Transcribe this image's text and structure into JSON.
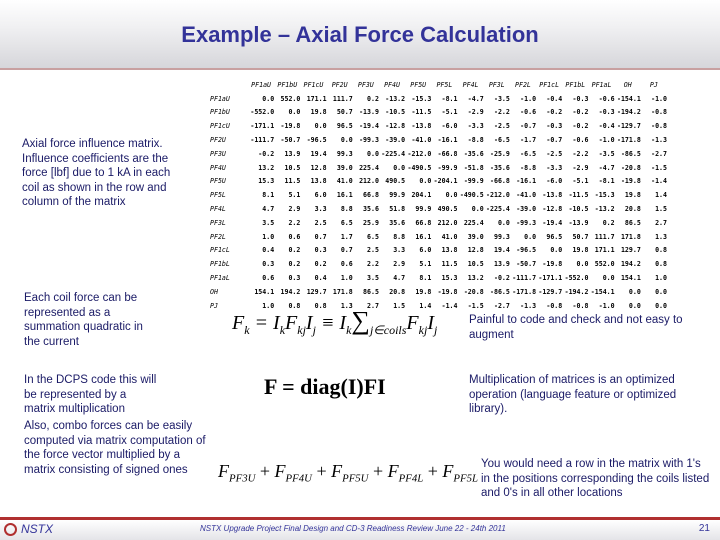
{
  "title": "Example – Axial Force Calculation",
  "matrix": {
    "col_headers": [
      "PF1aU",
      "PF1bU",
      "PF1cU",
      "PF2U",
      "PF3U",
      "PF4U",
      "PF5U",
      "PF5L",
      "PF4L",
      "PF3L",
      "PF2L",
      "PF1cL",
      "PF1bL",
      "PF1aL",
      "OH",
      "PJ"
    ],
    "rows": [
      {
        "label": "PF1aU",
        "values": [
          "0.0",
          "552.0",
          "171.1",
          "111.7",
          "0.2",
          "-13.2",
          "-15.3",
          "-8.1",
          "-4.7",
          "-3.5",
          "-1.0",
          "-0.4",
          "-0.3",
          "-0.6",
          "-154.1",
          "-1.0"
        ]
      },
      {
        "label": "PF1bU",
        "values": [
          "-552.0",
          "0.0",
          "19.8",
          "50.7",
          "-13.9",
          "-10.5",
          "-11.5",
          "-5.1",
          "-2.9",
          "-2.2",
          "-0.6",
          "-0.2",
          "-0.2",
          "-0.3",
          "-194.2",
          "-0.8"
        ]
      },
      {
        "label": "PF1cU",
        "values": [
          "-171.1",
          "-19.8",
          "0.0",
          "96.5",
          "-19.4",
          "-12.8",
          "-13.8",
          "-6.0",
          "-3.3",
          "-2.5",
          "-0.7",
          "-0.3",
          "-0.2",
          "-0.4",
          "-129.7",
          "-0.8"
        ]
      },
      {
        "label": "PF2U",
        "values": [
          "-111.7",
          "-50.7",
          "-96.5",
          "0.0",
          "-99.3",
          "-39.0",
          "-41.0",
          "-16.1",
          "-8.8",
          "-6.5",
          "-1.7",
          "-0.7",
          "-0.6",
          "-1.0",
          "-171.8",
          "-1.3"
        ]
      },
      {
        "label": "PF3U",
        "values": [
          "-0.2",
          "13.9",
          "19.4",
          "99.3",
          "0.0",
          "-225.4",
          "-212.0",
          "-66.8",
          "-35.6",
          "-25.9",
          "-6.5",
          "-2.5",
          "-2.2",
          "-3.5",
          "-86.5",
          "-2.7"
        ]
      },
      {
        "label": "PF4U",
        "values": [
          "13.2",
          "10.5",
          "12.8",
          "39.0",
          "225.4",
          "0.0",
          "-490.5",
          "-99.9",
          "-51.8",
          "-35.6",
          "-8.8",
          "-3.3",
          "-2.9",
          "-4.7",
          "-20.8",
          "-1.5"
        ]
      },
      {
        "label": "PF5U",
        "values": [
          "15.3",
          "11.5",
          "13.8",
          "41.0",
          "212.0",
          "490.5",
          "0.0",
          "-204.1",
          "-99.9",
          "-66.8",
          "-16.1",
          "-6.0",
          "-5.1",
          "-8.1",
          "-19.8",
          "-1.4"
        ]
      },
      {
        "label": "PF5L",
        "values": [
          "8.1",
          "5.1",
          "6.0",
          "16.1",
          "66.8",
          "99.9",
          "204.1",
          "0.0",
          "-490.5",
          "-212.0",
          "-41.0",
          "-13.8",
          "-11.5",
          "-15.3",
          "19.8",
          "1.4"
        ]
      },
      {
        "label": "PF4L",
        "values": [
          "4.7",
          "2.9",
          "3.3",
          "8.8",
          "35.6",
          "51.8",
          "99.9",
          "490.5",
          "0.0",
          "-225.4",
          "-39.0",
          "-12.8",
          "-10.5",
          "-13.2",
          "20.8",
          "1.5"
        ]
      },
      {
        "label": "PF3L",
        "values": [
          "3.5",
          "2.2",
          "2.5",
          "6.5",
          "25.9",
          "35.6",
          "66.8",
          "212.0",
          "225.4",
          "0.0",
          "-99.3",
          "-19.4",
          "-13.9",
          "0.2",
          "86.5",
          "2.7"
        ]
      },
      {
        "label": "PF2L",
        "values": [
          "1.0",
          "0.6",
          "0.7",
          "1.7",
          "6.5",
          "8.8",
          "16.1",
          "41.0",
          "39.0",
          "99.3",
          "0.0",
          "96.5",
          "50.7",
          "111.7",
          "171.8",
          "1.3"
        ]
      },
      {
        "label": "PF1cL",
        "values": [
          "0.4",
          "0.2",
          "0.3",
          "0.7",
          "2.5",
          "3.3",
          "6.0",
          "13.8",
          "12.8",
          "19.4",
          "-96.5",
          "0.0",
          "19.8",
          "171.1",
          "129.7",
          "0.8"
        ]
      },
      {
        "label": "PF1bL",
        "values": [
          "0.3",
          "0.2",
          "0.2",
          "0.6",
          "2.2",
          "2.9",
          "5.1",
          "11.5",
          "10.5",
          "13.9",
          "-50.7",
          "-19.8",
          "0.0",
          "552.0",
          "194.2",
          "0.8"
        ]
      },
      {
        "label": "PF1aL",
        "values": [
          "0.6",
          "0.3",
          "0.4",
          "1.0",
          "3.5",
          "4.7",
          "8.1",
          "15.3",
          "13.2",
          "-0.2",
          "-111.7",
          "-171.1",
          "-552.0",
          "0.0",
          "154.1",
          "1.0"
        ]
      },
      {
        "label": "OH",
        "values": [
          "154.1",
          "194.2",
          "129.7",
          "171.8",
          "86.5",
          "20.8",
          "19.8",
          "-19.8",
          "-20.8",
          "-86.5",
          "-171.8",
          "-129.7",
          "-194.2",
          "-154.1",
          "0.0",
          "0.0"
        ]
      },
      {
        "label": "PJ",
        "values": [
          "1.0",
          "0.8",
          "0.8",
          "1.3",
          "2.7",
          "1.5",
          "1.4",
          "-1.4",
          "-1.5",
          "-2.7",
          "-1.3",
          "-0.8",
          "-0.8",
          "-1.0",
          "0.0",
          "0.0"
        ]
      }
    ]
  },
  "left_texts": {
    "matrix_desc": "Axial force influence matrix. Influence coefficients are the force [lbf] due to 1 kA in each coil as shown in the row and column of the matrix",
    "coil_force": "Each coil force can be represented as a summation quadratic in the current",
    "dcps": "In the DCPS  code this will be represented by a matrix multiplication",
    "combo": "Also, combo forces can be easily computed via matrix computation of the force vector multiplied by a matrix consisting of signed ones"
  },
  "right_texts": {
    "painful": "Painful to code and check and not easy to augment",
    "optimized": "Multiplication of matrices is an optimized operation (language feature or optimized library).",
    "row_needed": "You would need a row in the matrix with 1's in the positions corresponding the coils listed and 0's in all other locations"
  },
  "formulas": {
    "sum_formula": "F_k = I_k F_kj I_j ≡ I_k Σ_{j∈coils} F_kj I_j",
    "diag_formula": "F = diag(I)FI",
    "combo_terms": [
      "PF3U",
      "PF4U",
      "PF5U",
      "PF4L",
      "PF5L"
    ]
  },
  "footer": {
    "logo": "NSTX",
    "text": "NSTX Upgrade Project Final Design and CD-3 Readiness Review June 22 - 24th 2011",
    "page": "21"
  }
}
